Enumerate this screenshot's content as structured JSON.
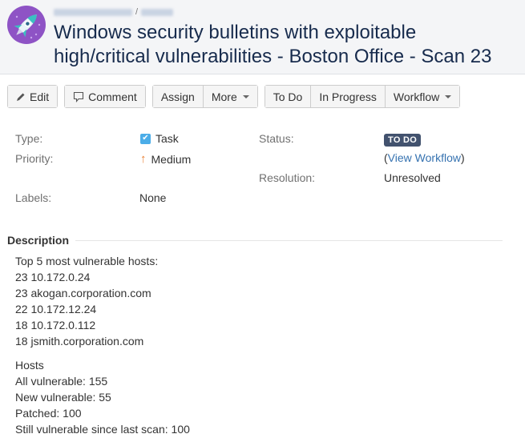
{
  "header": {
    "breadcrumb_redacted": true,
    "title": "Windows security bulletins with exploitable high/critical vulnerabilities - Boston Office - Scan 23"
  },
  "toolbar": {
    "edit": "Edit",
    "comment": "Comment",
    "assign": "Assign",
    "more": "More",
    "todo": "To Do",
    "in_progress": "In Progress",
    "workflow": "Workflow"
  },
  "details": {
    "type_label": "Type:",
    "type_value": "Task",
    "priority_label": "Priority:",
    "priority_value": "Medium",
    "labels_label": "Labels:",
    "labels_value": "None",
    "status_label": "Status:",
    "status_value": "TO DO",
    "view_workflow_open": "(",
    "view_workflow": "View Workflow",
    "view_workflow_close": ")",
    "resolution_label": "Resolution:",
    "resolution_value": "Unresolved"
  },
  "description": {
    "title": "Description",
    "top_hosts_heading": "Top 5 most vulnerable hosts:",
    "top_hosts": [
      "23 10.172.0.24",
      "23 akogan.corporation.com",
      "22 10.172.12.24",
      "18 10.172.0.112",
      "18 jsmith.corporation.com"
    ],
    "hosts_heading": "Hosts",
    "hosts_stats": [
      "All vulnerable: 155",
      "New vulnerable: 55",
      "Patched: 100",
      "Still vulnerable since last scan: 100"
    ]
  },
  "colors": {
    "accent_link": "#3572b0",
    "status_badge": "#42526e",
    "priority_medium": "#e97f33",
    "task_icon": "#4bade8",
    "avatar_bg": "#8e53c5"
  }
}
